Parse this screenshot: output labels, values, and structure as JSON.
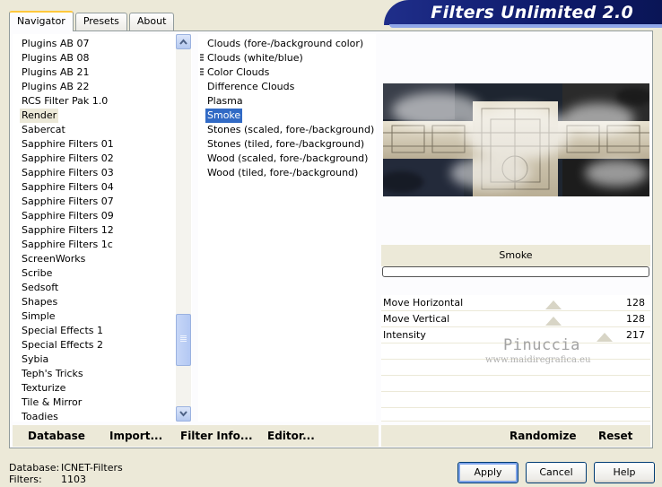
{
  "tabs": [
    {
      "label": "Navigator",
      "active": true
    },
    {
      "label": "Presets",
      "active": false
    },
    {
      "label": "About",
      "active": false
    }
  ],
  "banner": {
    "title": "Filters Unlimited 2.0"
  },
  "categories": {
    "items": [
      "Plugins AB 07",
      "Plugins AB 08",
      "Plugins AB 21",
      "Plugins AB 22",
      "RCS Filter Pak 1.0",
      "Render",
      "Sabercat",
      "Sapphire Filters 01",
      "Sapphire Filters 02",
      "Sapphire Filters 03",
      "Sapphire Filters 04",
      "Sapphire Filters 07",
      "Sapphire Filters 09",
      "Sapphire Filters 12",
      "Sapphire Filters 1c",
      "ScreenWorks",
      "Scribe",
      "Sedsoft",
      "Shapes",
      "Simple",
      "Special Effects 1",
      "Special Effects 2",
      "Sybia",
      "Teph's Tricks",
      "Texturize",
      "Tile & Mirror",
      "Toadies"
    ],
    "selected": "Render"
  },
  "filters": {
    "items": [
      "Clouds (fore-/background color)",
      "Clouds (white/blue)",
      "Color Clouds",
      "Difference Clouds",
      "Plasma",
      "Smoke",
      "Stones (scaled, fore-/background)",
      "Stones (tiled, fore-/background)",
      "Wood (scaled, fore-/background)",
      "Wood (tiled, fore-/background)"
    ],
    "selected": "Smoke"
  },
  "preview": {
    "filter_name": "Smoke"
  },
  "controls": [
    {
      "label": "Move Horizontal",
      "value": "128",
      "level": 0.5
    },
    {
      "label": "Move Vertical",
      "value": "128",
      "level": 0.5
    },
    {
      "label": "Intensity",
      "value": "217",
      "level": 0.85
    }
  ],
  "watermark": {
    "name": "Pinuccia",
    "url": "www.maidiregrafica.eu"
  },
  "buttons": {
    "database": "Database",
    "import": "Import...",
    "filter_info": "Filter Info...",
    "editor": "Editor...",
    "randomize": "Randomize",
    "reset": "Reset",
    "apply": "Apply",
    "cancel": "Cancel",
    "help": "Help"
  },
  "footer": {
    "database_label": "Database:",
    "database_value": "ICNET-Filters",
    "filters_label": "Filters:",
    "filters_value": "1103"
  },
  "colors": {
    "selection": "#316ac5",
    "banner": "#0e1a6a",
    "dialog_bg": "#ece9d8"
  }
}
